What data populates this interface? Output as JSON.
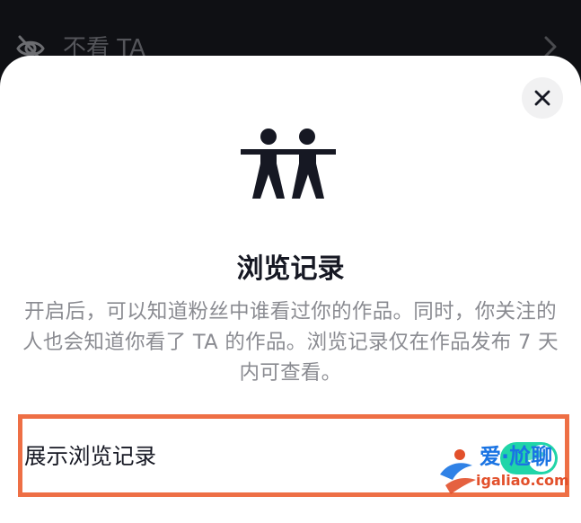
{
  "background_row": {
    "label": "不看 TA",
    "icon": "eye-off-icon",
    "chevron_icon": "chevron-right-icon"
  },
  "sheet": {
    "close_icon": "close-icon",
    "hero_icon": "two-people-icon",
    "title": "浏览记录",
    "description": "开启后，可以知道粉丝中谁看过你的作品。同时，你关注的人也会知道你看了 TA 的作品。浏览记录仅在作品发布 7 天内可查看。",
    "setting": {
      "label": "展示浏览记录",
      "toggle_state": "on"
    }
  },
  "watermark": {
    "text_primary": "爱·尬聊",
    "text_secondary": "igaliao.com"
  },
  "colors": {
    "highlight_border": "#ee6f45",
    "toggle_on": "#20d5a8",
    "title_text": "#161823",
    "desc_text": "#8a8b91",
    "backdrop": "#0f1014"
  }
}
